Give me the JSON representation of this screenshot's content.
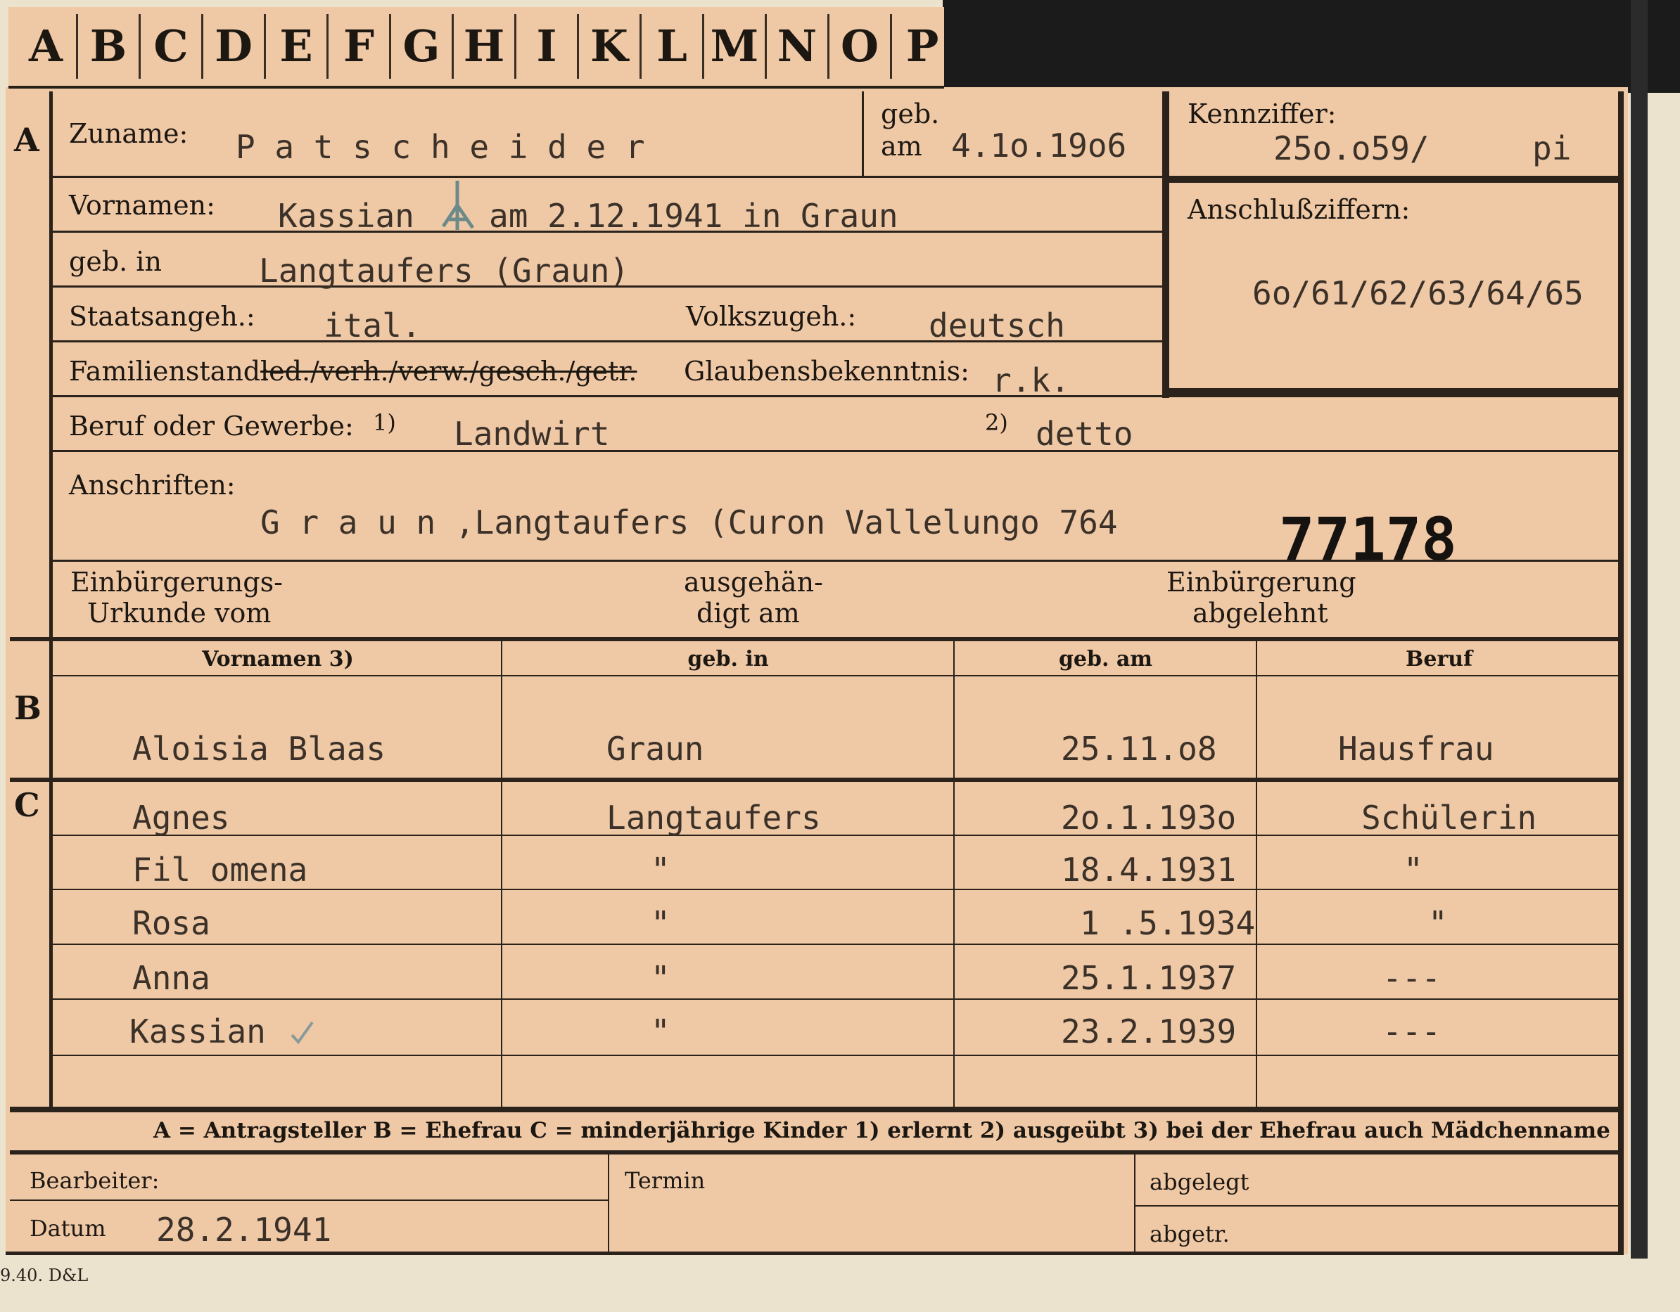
{
  "tabs": [
    "A",
    "B",
    "C",
    "D",
    "E",
    "F",
    "G",
    "H",
    "I",
    "K",
    "L",
    "M",
    "N",
    "O",
    "P"
  ],
  "sections": {
    "a": "A",
    "b": "B",
    "c": "C"
  },
  "applicant": {
    "surname_label": "Zuname:",
    "surname": "P a t s c h e i d e r",
    "born_label_1": "geb.",
    "born_label_2": "am",
    "born_date": "4.1o.19o6",
    "firstname_label": "Vornamen:",
    "firstname": "Kassian",
    "firstname_note": "am 2.12.1941 in Graun",
    "birthplace_label": "geb. in",
    "birthplace": "Langtaufers (Graun)",
    "citizenship_label": "Staatsangeh.:",
    "citizenship": "ital.",
    "ethnicity_label": "Volkszugeh.:",
    "ethnicity": "deutsch",
    "marital_label": "Familienstand:",
    "marital_options": "led./verh./verw./gesch./getr.",
    "religion_label": "Glaubensbekenntnis:",
    "religion": "r.k.",
    "profession_label": "Beruf oder Gewerbe:",
    "profession_learned_mark": "1)",
    "profession_learned": "Landwirt",
    "profession_practiced_mark": "2)",
    "profession_practiced": "detto",
    "address_label": "Anschriften:",
    "address": "G r a u n ,Langtaufers (Curon Vallelungo 764",
    "file_number": "77178",
    "naturalization_label_1": "Einbürgerungs-",
    "naturalization_label_2": "Urkunde vom",
    "handed_label_1": "ausgehän-",
    "handed_label_2": "digt am",
    "rejected_label_1": "Einbürgerung",
    "rejected_label_2": "abgelehnt"
  },
  "reference": {
    "label": "Kennziffer:",
    "value": "25o.o59/",
    "suffix": "pi",
    "attached_label": "Anschlußziffern:",
    "attached_value": "6o/61/62/63/64/65"
  },
  "family_table": {
    "headers": [
      "Vornamen 3)",
      "geb. in",
      "geb. am",
      "Beruf"
    ],
    "spouse": {
      "name": "Aloisia Blaas",
      "birthplace": "Graun",
      "born": "25.11.o8",
      "profession": "Hausfrau"
    },
    "children": [
      {
        "name": "Agnes",
        "birthplace": "Langtaufers",
        "born": "2o.1.193o",
        "profession": "Schülerin"
      },
      {
        "name": "Fil omena",
        "birthplace": "\"",
        "born": "18.4.1931",
        "profession": "\""
      },
      {
        "name": "Rosa",
        "birthplace": "\"",
        "born": "1 .5.1934",
        "profession": "\""
      },
      {
        "name": "Anna",
        "birthplace": "\"",
        "born": "25.1.1937",
        "profession": "---"
      },
      {
        "name": "Kassian",
        "birthplace": "\"",
        "born": "23.2.1939",
        "profession": "---"
      }
    ]
  },
  "legend": "A = Antragsteller   B = Ehefrau   C = minderjährige Kinder   1) erlernt   2) ausgeübt   3) bei der Ehefrau auch Mädchenname",
  "footer": {
    "clerk_label": "Bearbeiter:",
    "date_label": "Datum",
    "date": "28.2.1941",
    "term_label": "Termin",
    "filed_label": "abgelegt",
    "removed_label": "abgetr.",
    "print_mark": "9.40. D&L"
  }
}
